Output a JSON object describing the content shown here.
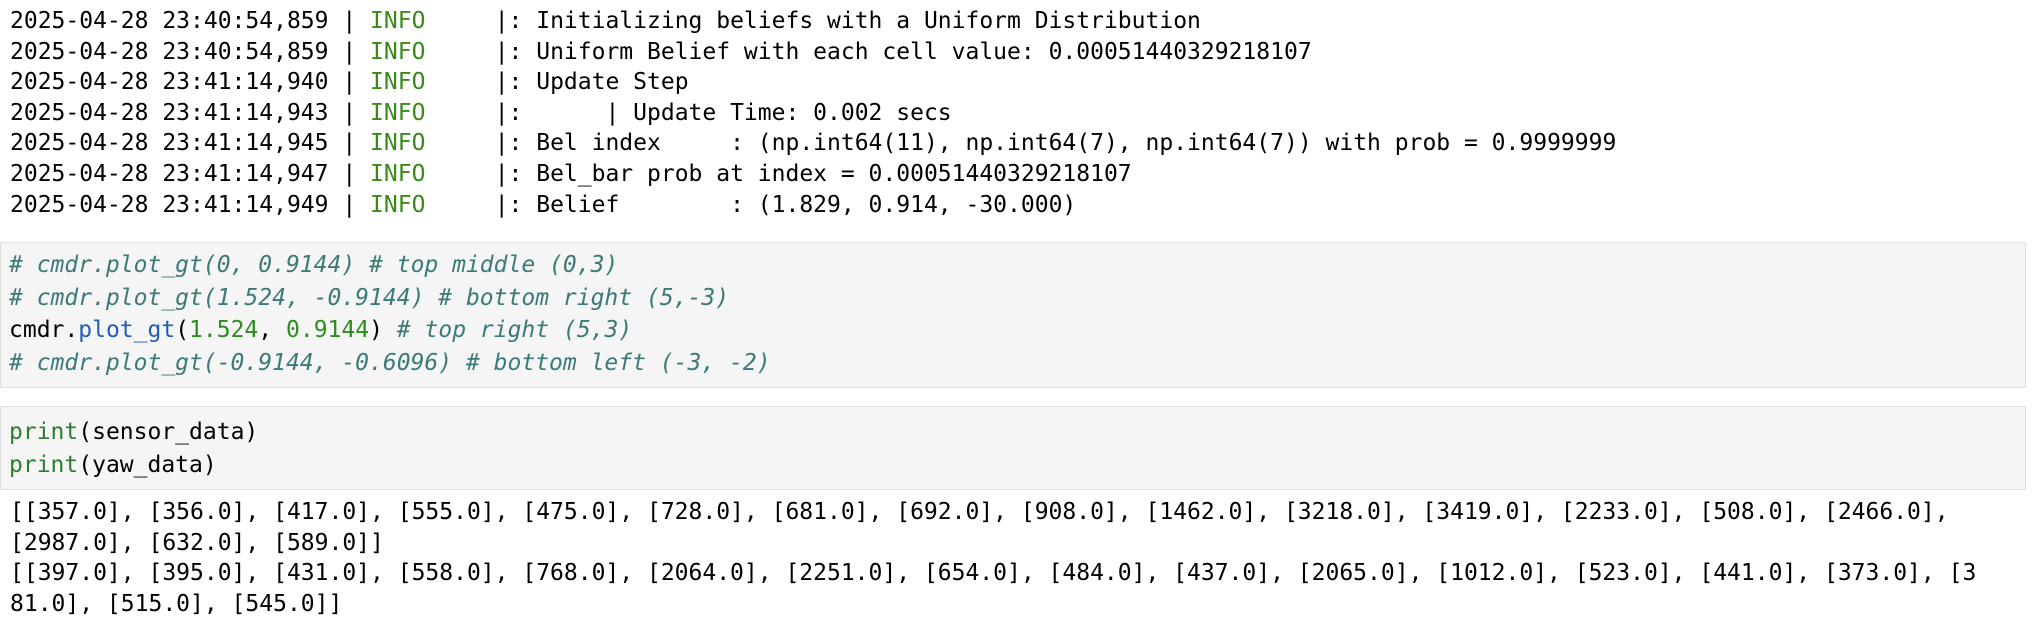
{
  "log_output": [
    {
      "timestamp": "2025-04-28 23:40:54,859",
      "level": "INFO",
      "message": "|: Initializing beliefs with a Uniform Distribution"
    },
    {
      "timestamp": "2025-04-28 23:40:54,859",
      "level": "INFO",
      "message": "|: Uniform Belief with each cell value: 0.00051440329218107"
    },
    {
      "timestamp": "2025-04-28 23:41:14,940",
      "level": "INFO",
      "message": "|: Update Step"
    },
    {
      "timestamp": "2025-04-28 23:41:14,943",
      "level": "INFO",
      "message": "|:      | Update Time: 0.002 secs"
    },
    {
      "timestamp": "2025-04-28 23:41:14,945",
      "level": "INFO",
      "message": "|: Bel index     : (np.int64(11), np.int64(7), np.int64(7)) with prob = 0.9999999"
    },
    {
      "timestamp": "2025-04-28 23:41:14,947",
      "level": "INFO",
      "message": "|: Bel_bar prob at index = 0.00051440329218107"
    },
    {
      "timestamp": "2025-04-28 23:41:14,949",
      "level": "INFO",
      "message": "|: Belief        : (1.829, 0.914, -30.000)"
    }
  ],
  "log_separator": " | ",
  "log_level_pad": "     ",
  "cell_plot": {
    "line1": "# cmdr.plot_gt(0, 0.9144) # top middle (0,3)",
    "line2": "# cmdr.plot_gt(1.524, -0.9144) # bottom right (5,-3)",
    "line3": {
      "object": "cmdr",
      "dot": ".",
      "function": "plot_gt",
      "open": "(",
      "arg1": "1.524",
      "comma": ", ",
      "arg2": "0.9144",
      "close": ")",
      "comment": " # top right (5,3)"
    },
    "line4": "# cmdr.plot_gt(-0.9144, -0.6096) # bottom left (-3, -2)"
  },
  "cell_print": {
    "line1": {
      "builtin": "print",
      "args": "(sensor_data)"
    },
    "line2": {
      "builtin": "print",
      "args": "(yaw_data)"
    }
  },
  "print_output": [
    "[[357.0], [356.0], [417.0], [555.0], [475.0], [728.0], [681.0], [692.0], [908.0], [1462.0], [3218.0], [3419.0], [2233.0], [508.0], [2466.0],",
    "[2987.0], [632.0], [589.0]]",
    "[[397.0], [395.0], [431.0], [558.0], [768.0], [2064.0], [2251.0], [654.0], [484.0], [437.0], [2065.0], [1012.0], [523.0], [441.0], [373.0], [3",
    "81.0], [515.0], [545.0]]"
  ]
}
